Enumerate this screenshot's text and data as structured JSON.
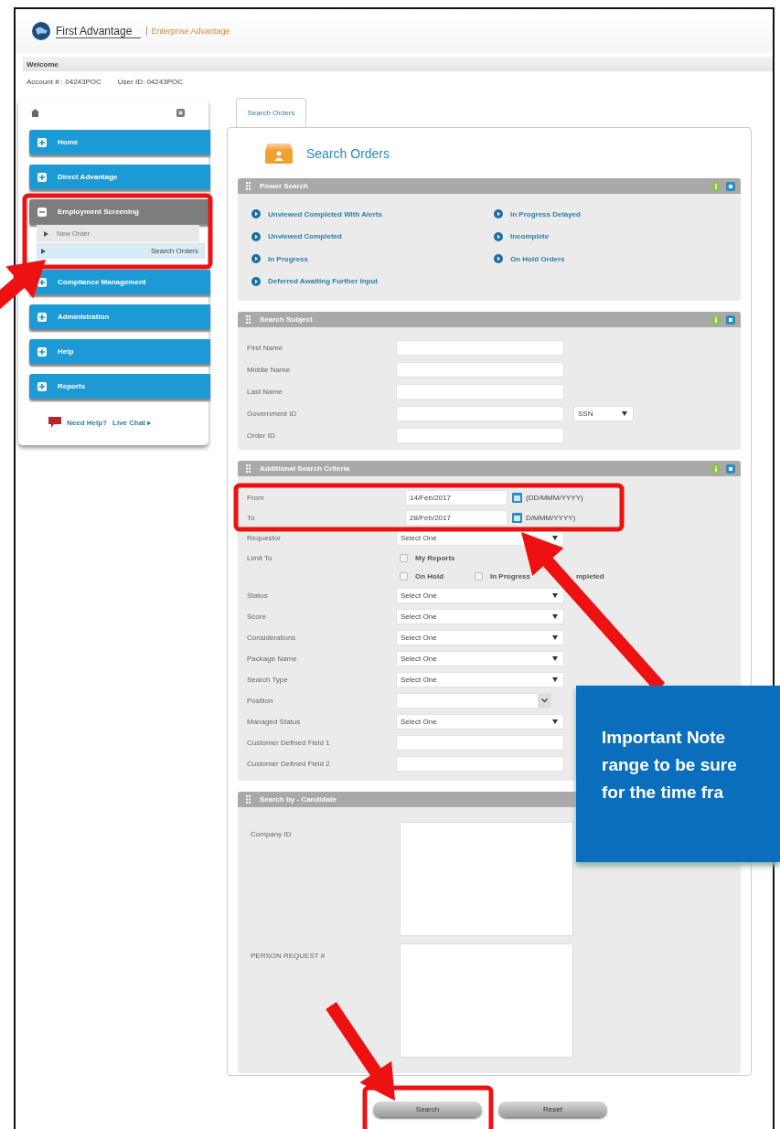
{
  "header": {
    "brand": "First Advantage",
    "product": "Enterprise Advantage",
    "welcome": "Welcome",
    "account": "Account # : 04243POC",
    "user_id": "User ID: 04243POC"
  },
  "sidebar": {
    "items": [
      {
        "label": "Home",
        "expanded": false
      },
      {
        "label": "Direct Advantage",
        "expanded": false
      },
      {
        "label": "Employment Screening",
        "expanded": true,
        "children": [
          {
            "label": "New Order",
            "selected": false
          },
          {
            "label": "Search Orders",
            "selected": true
          }
        ]
      },
      {
        "label": "Compliance Management",
        "expanded": false
      },
      {
        "label": "Administration",
        "expanded": false
      },
      {
        "label": "Help",
        "expanded": false
      },
      {
        "label": "Reports",
        "expanded": false
      }
    ],
    "help": "Need Help?",
    "chat": "Live Chat ▸"
  },
  "tabs": [
    {
      "label": "Search Orders",
      "selected": true
    }
  ],
  "panel": {
    "title": "Search Orders"
  },
  "power_search": {
    "title": "Power Search",
    "tools": true,
    "links": [
      "Unviewed Completed With Alerts",
      "In Progress Delayed",
      "Unviewed Completed",
      "Incomplete",
      "In Progress",
      "On Hold Orders",
      "Deferred Awaiting Further Input"
    ]
  },
  "search_subject": {
    "title": "Search Subject",
    "tools": true,
    "fields": [
      {
        "kind": "text",
        "label": "First Name"
      },
      {
        "kind": "text",
        "label": "Middle Name"
      },
      {
        "kind": "text",
        "label": "Last Name"
      },
      {
        "kind": "text",
        "label": "Government ID",
        "select": "SSN"
      },
      {
        "kind": "text",
        "label": "Order ID"
      }
    ]
  },
  "additional_criteria": {
    "title": "Additional Search Criteria",
    "tools": true,
    "fields": [
      {
        "kind": "date",
        "label": "From",
        "value": "14/Feb/2017",
        "hint": "(DD/MMM/YYYY)"
      },
      {
        "kind": "date",
        "label": "To",
        "value": "28/Feb/2017",
        "hint": "D/MMM/YYYY)"
      },
      {
        "kind": "select",
        "label": "Requestor",
        "value": "Select One"
      },
      {
        "kind": "checkboxes",
        "label": "Limit To",
        "options": [
          {
            "label": "My Reports",
            "checked": false
          }
        ]
      },
      {
        "kind": "checkboxes",
        "options": [
          {
            "label": "On Hold",
            "checked": false
          },
          {
            "label": "In Progress",
            "checked": false
          },
          {
            "label": "mpleted"
          }
        ]
      },
      {
        "kind": "select",
        "label": "Status",
        "value": "Select One"
      },
      {
        "kind": "select",
        "label": "Score",
        "value": "Select One"
      },
      {
        "kind": "select",
        "label": "Considerations",
        "value": "Select One"
      },
      {
        "kind": "select",
        "label": "Package Name",
        "value": "Select One"
      },
      {
        "kind": "select",
        "label": "Search Type",
        "value": "Select One"
      },
      {
        "kind": "combo",
        "label": "Position"
      },
      {
        "kind": "select",
        "label": "Managed Status",
        "value": "Select One"
      },
      {
        "kind": "text",
        "label": "Customer Defined Field 1"
      },
      {
        "kind": "text",
        "label": "Customer Defined Field 2"
      }
    ]
  },
  "candidate": {
    "title": "Search by - Candidate",
    "fields": [
      {
        "label": "Company ID"
      },
      {
        "label": "PERSON REQUEST #"
      }
    ]
  },
  "buttons": [
    "Search",
    "Reset"
  ],
  "callout": {
    "lines": [
      "Important Note",
      "range to be sure",
      "for the time fra"
    ]
  }
}
